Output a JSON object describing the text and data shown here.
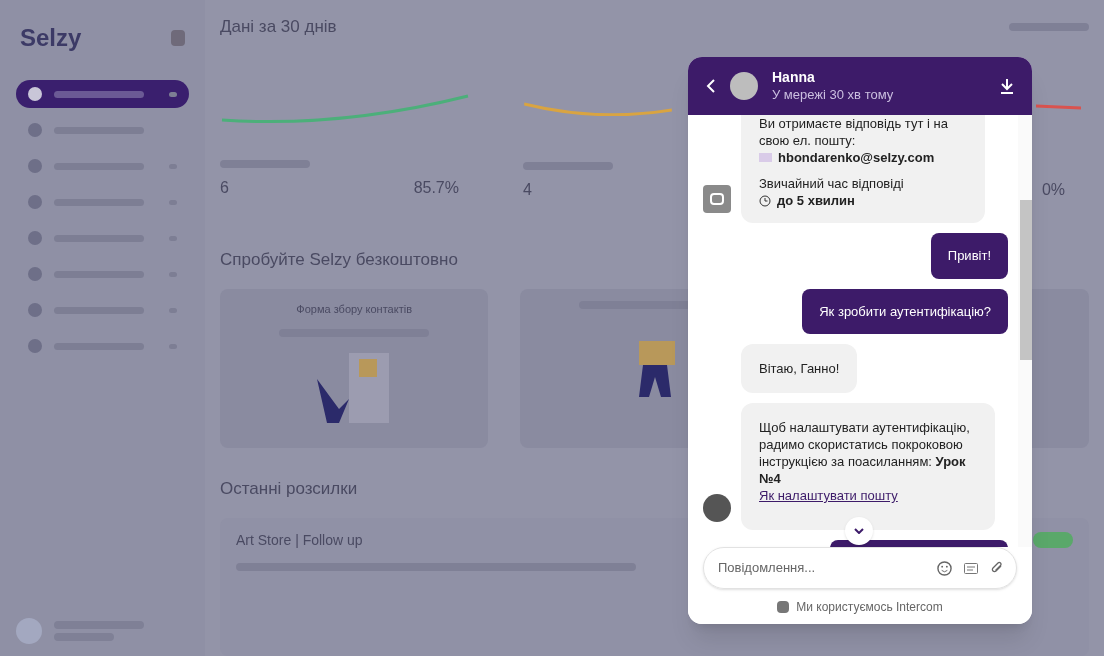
{
  "sidebar": {
    "logo": "Selzy",
    "items": [
      {
        "selected": true,
        "has_arrow": true
      },
      {
        "selected": false,
        "has_arrow": false
      },
      {
        "selected": false,
        "has_arrow": true
      },
      {
        "selected": false,
        "has_arrow": true
      },
      {
        "selected": false,
        "has_arrow": true
      },
      {
        "selected": false,
        "has_arrow": true
      },
      {
        "selected": false,
        "has_arrow": true
      },
      {
        "selected": false,
        "has_arrow": true
      }
    ]
  },
  "dashboard": {
    "title": "Дані за 30 днів",
    "stats": [
      {
        "value": "6",
        "percent": "85.7%",
        "color": "#4caf7a"
      },
      {
        "value": "4",
        "color": "#d9a441"
      },
      {
        "percent": "0%",
        "color": "#d9534f"
      }
    ],
    "promo_title": "Спробуйте Selzy безкоштовно",
    "promo_cards": [
      {
        "kind": "form",
        "title": "Форма збору контактів"
      },
      {
        "kind": "courier"
      },
      {
        "kind": "blank"
      }
    ],
    "recent_title": "Останні розсилки",
    "campaign": {
      "name": "Art Store | Follow up",
      "color": "#5aa86a"
    }
  },
  "chat": {
    "name": "Hanna",
    "status": "У мережі 30 хв тому",
    "messages": [
      {
        "kind": "info",
        "text": "Ви отримаєте відповідь тут і на свою ел. пошту:",
        "email": "hbondarenko@selzy.com",
        "response_label": "Звичайний час відповіді",
        "response_time": "до 5 хвилин"
      },
      {
        "kind": "user",
        "text": "Привіт!"
      },
      {
        "kind": "user",
        "text": "Як зробити аутентифікацію?"
      },
      {
        "kind": "agent",
        "text": "Вітаю, Ганно!",
        "avatar": false
      },
      {
        "kind": "agent",
        "text": "Щоб налаштувати аутентифікацію, радимо скористатись покроковою інструкцією за поасиланням: **Урок №4**",
        "link": "Як налаштувати пошту",
        "avatar": true
      },
      {
        "kind": "user"
      }
    ],
    "composer": {
      "placeholder": "Повідомлення..."
    },
    "footer": "Ми користуємось Intercom"
  }
}
